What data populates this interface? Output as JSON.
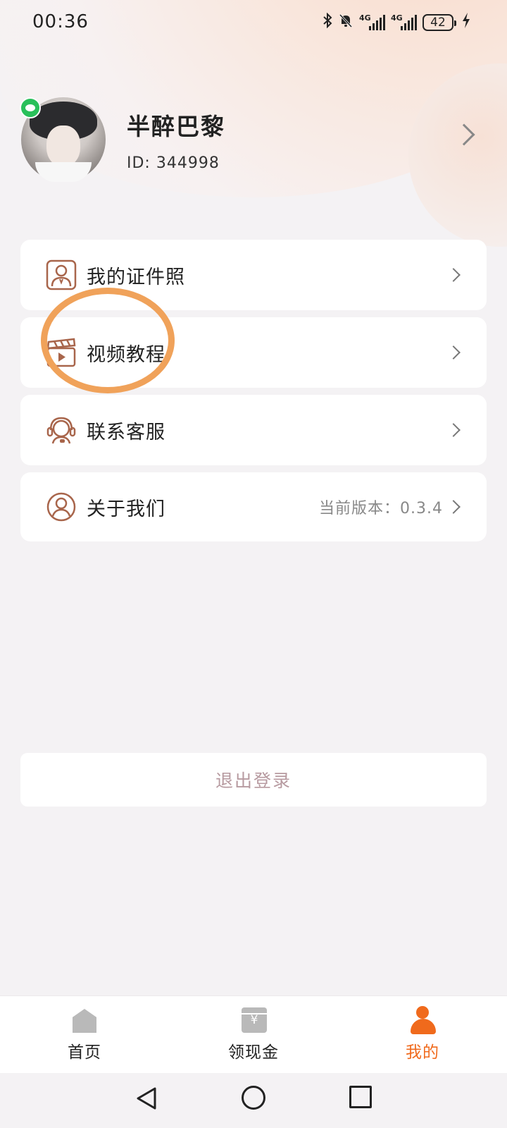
{
  "status_bar": {
    "time": "00:36",
    "network_1": "4G",
    "network_2": "4G",
    "battery": "42"
  },
  "profile": {
    "name": "半醉巴黎",
    "id_label": "ID:",
    "id_value": "344998"
  },
  "menu": {
    "items": [
      {
        "label": "我的证件照",
        "icon": "id-photo-icon"
      },
      {
        "label": "视频教程",
        "icon": "video-clapper-icon"
      },
      {
        "label": "联系客服",
        "icon": "customer-service-icon"
      },
      {
        "label": "关于我们",
        "icon": "about-user-icon",
        "extra": "当前版本：0.3.4"
      }
    ]
  },
  "logout_label": "退出登录",
  "bottom_nav": {
    "items": [
      {
        "label": "首页",
        "icon": "home-icon",
        "active": false
      },
      {
        "label": "领现金",
        "icon": "cash-icon",
        "active": false
      },
      {
        "label": "我的",
        "icon": "me-icon",
        "active": true
      }
    ]
  },
  "colors": {
    "accent": "#f06a1c",
    "icon_brown": "#a8654b",
    "highlight_ring": "#f0a25a",
    "wechat_green": "#29c05a"
  }
}
